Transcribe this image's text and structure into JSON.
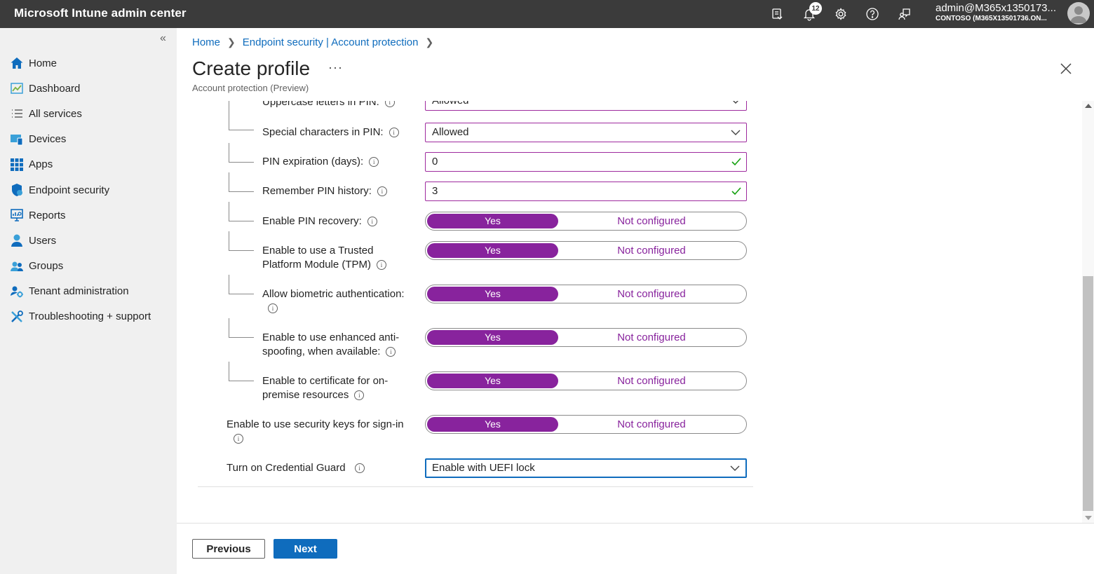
{
  "app": {
    "title": "Microsoft Intune admin center"
  },
  "header": {
    "notification_count": "12",
    "account_user": "admin@M365x1350173...",
    "account_tenant": "CONTOSO (M365X13501736.ON...",
    "icons": [
      "remote-help-icon",
      "bell-icon",
      "gear-icon",
      "help-icon",
      "feedback-icon",
      "avatar"
    ]
  },
  "sidebar": {
    "collapse": "«",
    "items": [
      {
        "label": "Home",
        "icon": "home-icon"
      },
      {
        "label": "Dashboard",
        "icon": "dashboard-icon"
      },
      {
        "label": "All services",
        "icon": "list-icon"
      },
      {
        "label": "Devices",
        "icon": "devices-icon"
      },
      {
        "label": "Apps",
        "icon": "apps-icon"
      },
      {
        "label": "Endpoint security",
        "icon": "shield-icon"
      },
      {
        "label": "Reports",
        "icon": "reports-icon"
      },
      {
        "label": "Users",
        "icon": "user-icon"
      },
      {
        "label": "Groups",
        "icon": "groups-icon"
      },
      {
        "label": "Tenant administration",
        "icon": "tenant-icon"
      },
      {
        "label": "Troubleshooting + support",
        "icon": "tools-icon"
      }
    ]
  },
  "breadcrumb": {
    "home": "Home",
    "section": "Endpoint security | Account protection"
  },
  "page": {
    "title": "Create profile",
    "more": "···",
    "subtitle": "Account protection (Preview)"
  },
  "settings": {
    "uppercase": {
      "label": "Uppercase letters in PIN:",
      "value": "Allowed"
    },
    "special": {
      "label": "Special characters in PIN:",
      "value": "Allowed"
    },
    "expiration": {
      "label": "PIN expiration (days):",
      "value": "0"
    },
    "history": {
      "label": "Remember PIN history:",
      "value": "3"
    },
    "recovery": {
      "label": "Enable PIN recovery:"
    },
    "tpm": {
      "label_line1": "Enable to use a Trusted",
      "label_line2": "Platform Module (TPM)"
    },
    "biometric": {
      "label": "Allow biometric authentication:"
    },
    "antispoof": {
      "label_line1": "Enable to use enhanced anti-",
      "label_line2": "spoofing, when available:"
    },
    "certificate": {
      "label_line1": "Enable to certificate for on-",
      "label_line2": "premise resources"
    },
    "security_keys": {
      "label": "Enable to use security keys for sign-in"
    },
    "credential_guard": {
      "label": "Turn on Credential Guard",
      "value": "Enable with UEFI lock"
    },
    "toggle_yes": "Yes",
    "toggle_not_configured": "Not configured",
    "info": "i"
  },
  "footer": {
    "previous": "Previous",
    "next": "Next"
  },
  "colors": {
    "accent": "#0f6cbd",
    "toggle_purple": "#88239d",
    "topbar": "#3b3b3b",
    "sidebar": "#f0f0f0"
  }
}
